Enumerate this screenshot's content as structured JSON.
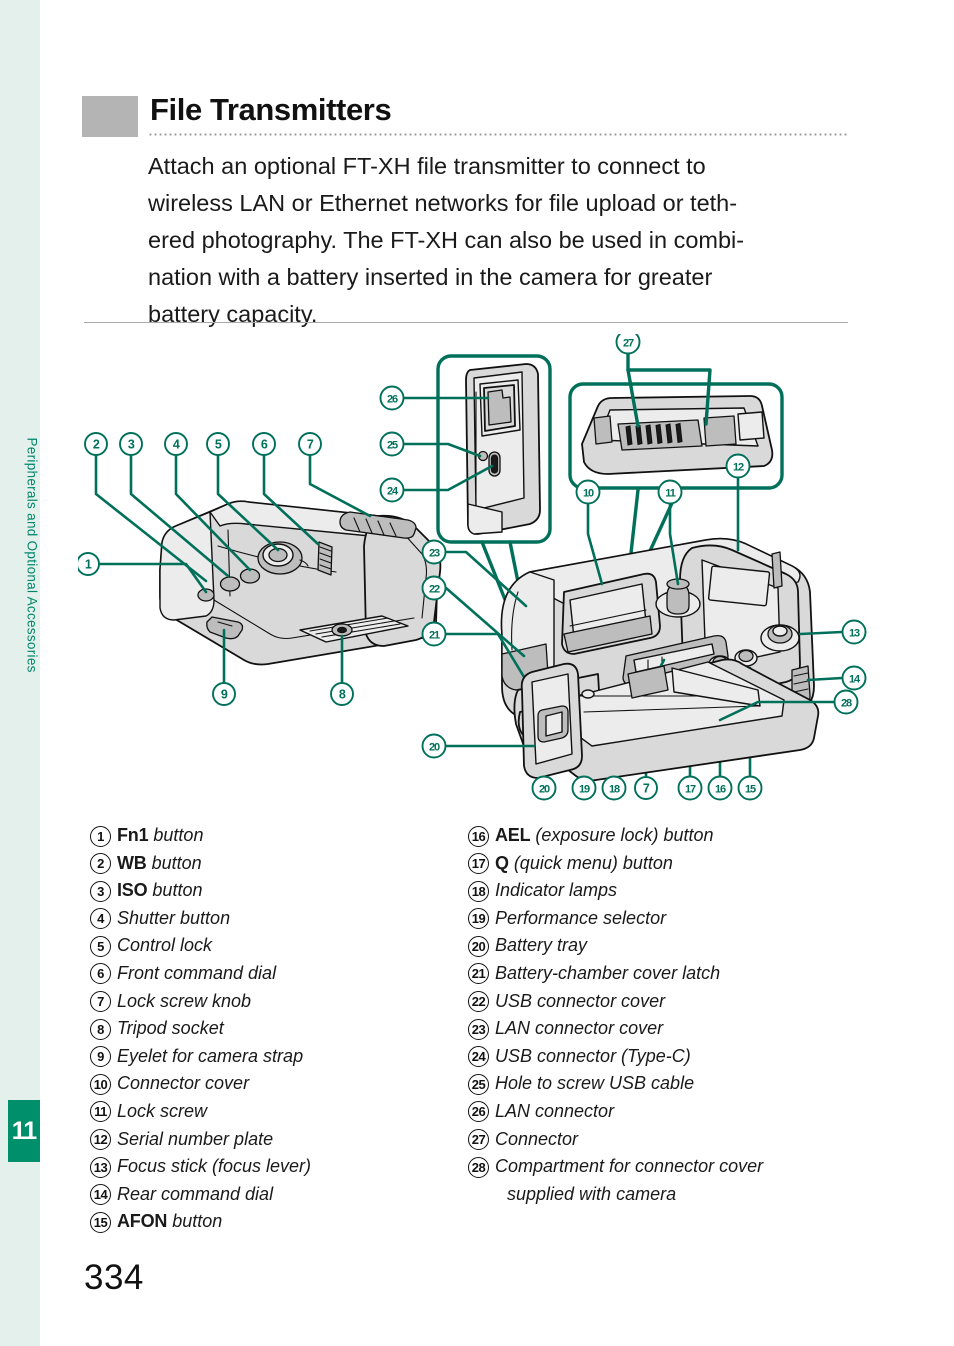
{
  "rail": {
    "section_label": "Peripherals and Optional Accessories",
    "chapter_number": "11",
    "tint_color": "#e4f0ec",
    "accent_color": "#008f6b"
  },
  "header": {
    "title": "File Transmitters",
    "swatch_color": "#b4b4b4"
  },
  "intro": {
    "line1": "Attach an optional FT-XH file transmitter to connect to",
    "line2": "wireless LAN or Ethernet networks for file upload or teth-",
    "line3": "ered photography. The FT-XH can also be used in combi-",
    "line4": "nation with a battery inserted in the camera for greater",
    "line5": "battery capacity."
  },
  "figure": {
    "callout_color": "#00705a",
    "body_fill": "#d9d9d9",
    "body_fill_light": "#ececec",
    "outline": "#111111",
    "callouts": [
      "1",
      "2",
      "3",
      "4",
      "5",
      "6",
      "7",
      "8",
      "9",
      "10",
      "11",
      "12",
      "13",
      "14",
      "15",
      "16",
      "17",
      "18",
      "19",
      "20",
      "21",
      "22",
      "23",
      "24",
      "25",
      "26",
      "27",
      "28"
    ]
  },
  "legend": {
    "left": [
      {
        "num": "1",
        "bold": "Fn1",
        "text": " button"
      },
      {
        "num": "2",
        "bold": "WB",
        "text": " button"
      },
      {
        "num": "3",
        "bold": "ISO",
        "text": " button"
      },
      {
        "num": "4",
        "bold": "",
        "text": "Shutter button"
      },
      {
        "num": "5",
        "bold": "",
        "text": "Control lock"
      },
      {
        "num": "6",
        "bold": "",
        "text": "Front command dial"
      },
      {
        "num": "7",
        "bold": "",
        "text": "Lock screw knob"
      },
      {
        "num": "8",
        "bold": "",
        "text": "Tripod socket"
      },
      {
        "num": "9",
        "bold": "",
        "text": "Eyelet for camera strap"
      },
      {
        "num": "10",
        "bold": "",
        "text": "Connector cover"
      },
      {
        "num": "11",
        "bold": "",
        "text": "Lock screw"
      },
      {
        "num": "12",
        "bold": "",
        "text": "Serial number plate"
      },
      {
        "num": "13",
        "bold": "",
        "text": "Focus stick (focus lever)"
      },
      {
        "num": "14",
        "bold": "",
        "text": "Rear command dial"
      },
      {
        "num": "15",
        "bold": "AFON",
        "text": " button"
      }
    ],
    "right": [
      {
        "num": "16",
        "bold": "AEL",
        "text": " (exposure lock) button"
      },
      {
        "num": "17",
        "bold": "Q",
        "text": " (quick menu) button"
      },
      {
        "num": "18",
        "bold": "",
        "text": "Indicator lamps"
      },
      {
        "num": "19",
        "bold": "",
        "text": "Performance selector"
      },
      {
        "num": "20",
        "bold": "",
        "text": "Battery tray"
      },
      {
        "num": "21",
        "bold": "",
        "text": "Battery-chamber cover latch"
      },
      {
        "num": "22",
        "bold": "",
        "text": "USB connector cover"
      },
      {
        "num": "23",
        "bold": "",
        "text": "LAN connector cover"
      },
      {
        "num": "24",
        "bold": "",
        "text": "USB connector (Type-C)"
      },
      {
        "num": "25",
        "bold": "",
        "text": "Hole to screw USB cable"
      },
      {
        "num": "26",
        "bold": "",
        "text": "LAN connector"
      },
      {
        "num": "27",
        "bold": "",
        "text": "Connector"
      },
      {
        "num": "28",
        "bold": "",
        "text": "Compartment for connector cover",
        "cont": "supplied with camera"
      }
    ]
  },
  "folio": {
    "page_number": "334"
  }
}
